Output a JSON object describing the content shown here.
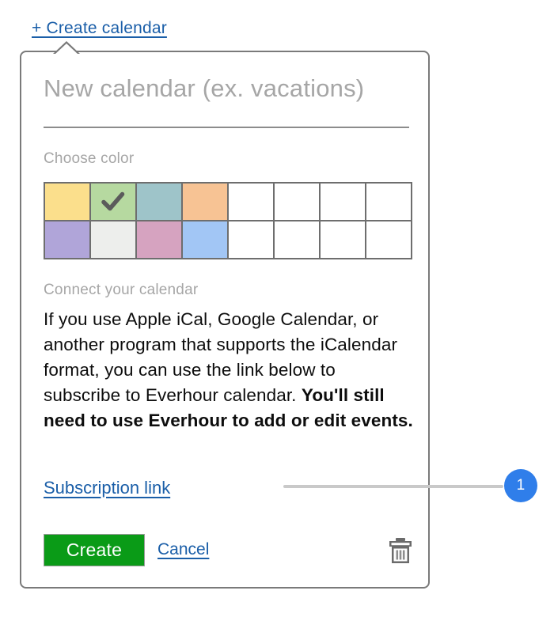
{
  "top_link": {
    "label": "+ Create calendar"
  },
  "dialog": {
    "name_input": {
      "value": "",
      "placeholder": "New calendar (ex. vacations)"
    },
    "choose_color": {
      "label": "Choose color",
      "columns": 8,
      "rows": 2,
      "selected_index": 1,
      "check_icon": "check-icon",
      "swatches": [
        {
          "name": "yellow",
          "color": "#fbdf8c",
          "selected": false
        },
        {
          "name": "green",
          "color": "#b6d9a0",
          "selected": true
        },
        {
          "name": "teal",
          "color": "#9ec4c9",
          "selected": false
        },
        {
          "name": "orange",
          "color": "#f7c394",
          "selected": false
        },
        {
          "name": "empty-1",
          "color": "#ffffff",
          "selected": false
        },
        {
          "name": "empty-2",
          "color": "#ffffff",
          "selected": false
        },
        {
          "name": "empty-3",
          "color": "#ffffff",
          "selected": false
        },
        {
          "name": "empty-4",
          "color": "#ffffff",
          "selected": false
        },
        {
          "name": "purple",
          "color": "#b0a5d9",
          "selected": false
        },
        {
          "name": "light-gray",
          "color": "#edeeec",
          "selected": false
        },
        {
          "name": "pink",
          "color": "#d6a3c0",
          "selected": false
        },
        {
          "name": "blue",
          "color": "#a2c6f5",
          "selected": false
        },
        {
          "name": "empty-5",
          "color": "#ffffff",
          "selected": false
        },
        {
          "name": "empty-6",
          "color": "#ffffff",
          "selected": false
        },
        {
          "name": "empty-7",
          "color": "#ffffff",
          "selected": false
        },
        {
          "name": "empty-8",
          "color": "#ffffff",
          "selected": false
        }
      ]
    },
    "connect": {
      "label": "Connect your calendar",
      "paragraph_plain": "If you use Apple iCal, Google Calendar, or another program that supports the iCalendar format, you can use the link below to subscribe to Everhour calendar. ",
      "paragraph_bold": "You'll still need to use Everhour to add or edit events.",
      "paragraph_tail": ""
    },
    "subscription_link": {
      "label": "Subscription link"
    },
    "footer": {
      "create_label": "Create",
      "cancel_label": "Cancel",
      "delete_icon": "trash-icon"
    }
  },
  "callout": {
    "number": "1",
    "color": "#2f7eea"
  }
}
